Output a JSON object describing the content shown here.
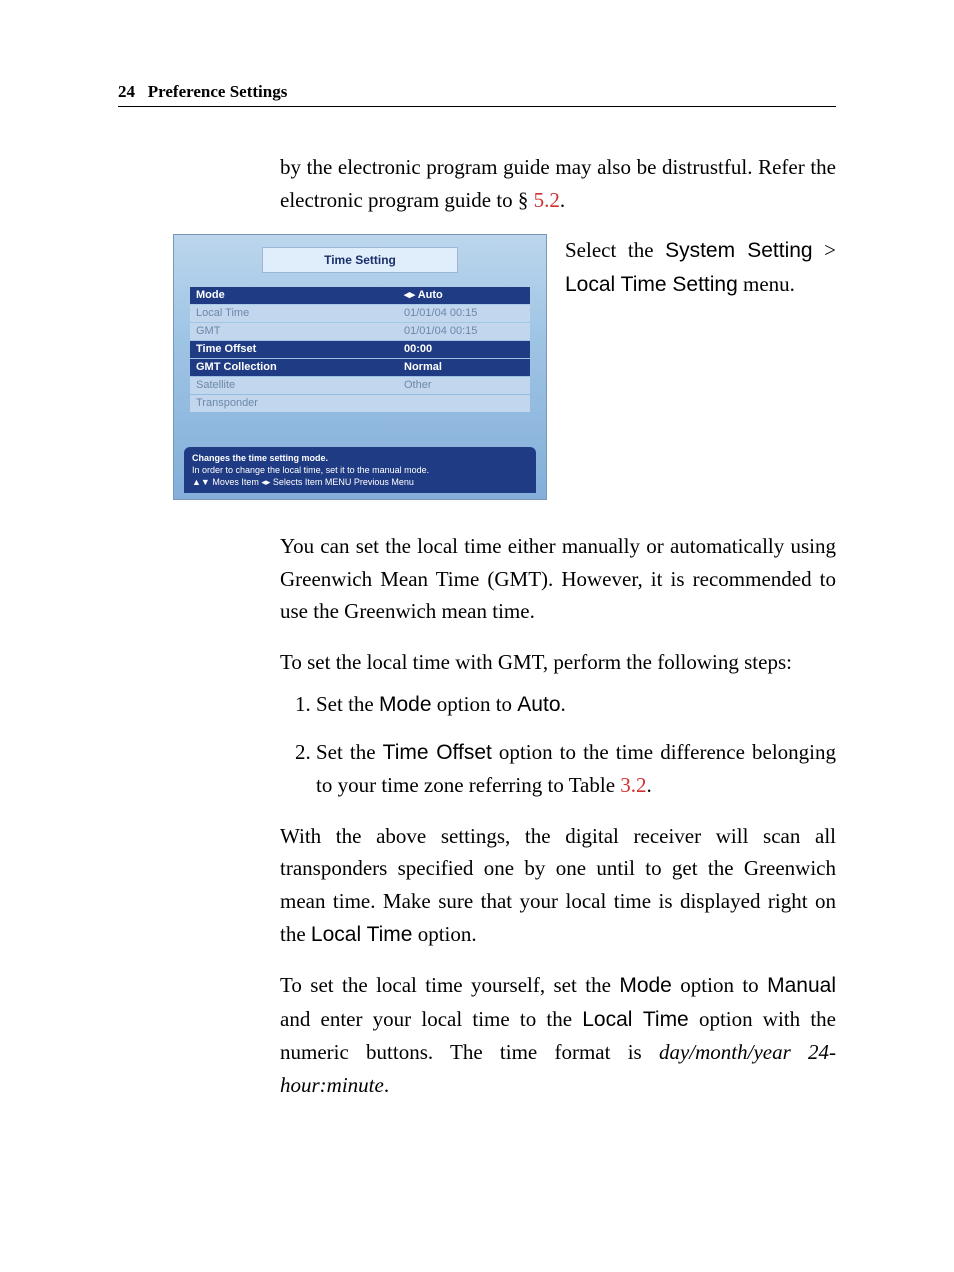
{
  "header": {
    "page_number": "24",
    "section_title": "Preference Settings"
  },
  "intro": {
    "pre_link": "by the electronic program guide may also be distrustful. Refer the electronic program guide to § ",
    "link": "5.2",
    "post_link": "."
  },
  "caption": {
    "pre": "Select the ",
    "path_a": "System Setting",
    "sep": " > ",
    "path_b": "Local Time Setting",
    "post": " menu."
  },
  "tv": {
    "title": "Time Setting",
    "rows": [
      {
        "label": "Mode",
        "value": "◂▸ Auto",
        "cls": "sel"
      },
      {
        "label": "Local Time",
        "value": "01/01/04 00:15",
        "cls": "dim"
      },
      {
        "label": "GMT",
        "value": "01/01/04 00:15",
        "cls": "dim"
      },
      {
        "label": "Time Offset",
        "value": "00:00",
        "cls": "act"
      },
      {
        "label": "GMT Collection",
        "value": "Normal",
        "cls": "act"
      },
      {
        "label": "Satellite",
        "value": "Other",
        "cls": "dim"
      },
      {
        "label": "Transponder",
        "value": "",
        "cls": "dim"
      }
    ],
    "hint1": "Changes the time setting mode.",
    "hint2": "In order to change the local time, set it to the manual mode.",
    "hint3": "▲▼ Moves Item ◂▸ Selects Item  MENU Previous Menu"
  },
  "p2": "You can set the local time either manually or automatically using Greenwich Mean Time (GMT). However, it is recommended to use the Greenwich mean time.",
  "p3": "To set the local time with GMT, perform the following steps:",
  "steps": {
    "s1": {
      "pre": "Set the ",
      "mode": "Mode",
      "mid": " option to ",
      "auto": "Auto",
      "post": "."
    },
    "s2": {
      "pre": "Set the ",
      "to": "Time Offset",
      "mid": " option to the time difference belonging to your time zone referring to Table ",
      "link": "3.2",
      "post": "."
    }
  },
  "p4": {
    "pre": "With the above settings, the digital receiver will scan all transponders specified one by one until to get the Greenwich mean time. Make sure that your local time is displayed right on the ",
    "lt": "Local Time",
    "post": " option."
  },
  "p5": {
    "a": "To set the local time yourself, set the ",
    "mode": "Mode",
    "b": " option to ",
    "manual": "Manual",
    "c": " and enter your local time to the ",
    "lt": "Local Time",
    "d": " option with the numeric buttons. The time format is ",
    "fmt": "day/month/year 24-hour:minute",
    "e": "."
  }
}
